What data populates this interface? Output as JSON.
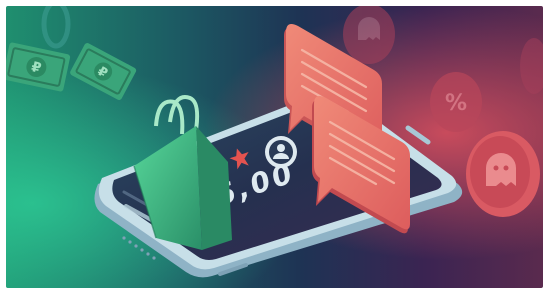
{
  "scene": {
    "rating_value": "5,00",
    "currency_symbol": "₽",
    "discount_symbol": "%",
    "background_colors": [
      "#1f8f6f",
      "#1e3b5a",
      "#2a2150",
      "#b0435c"
    ],
    "accent_colors": {
      "bag_green": "#3fb884",
      "chat_salmon": "#ec7166",
      "star_red": "#e4534f",
      "phone_body": "#b9d4e0",
      "screen": "#26324f"
    }
  }
}
